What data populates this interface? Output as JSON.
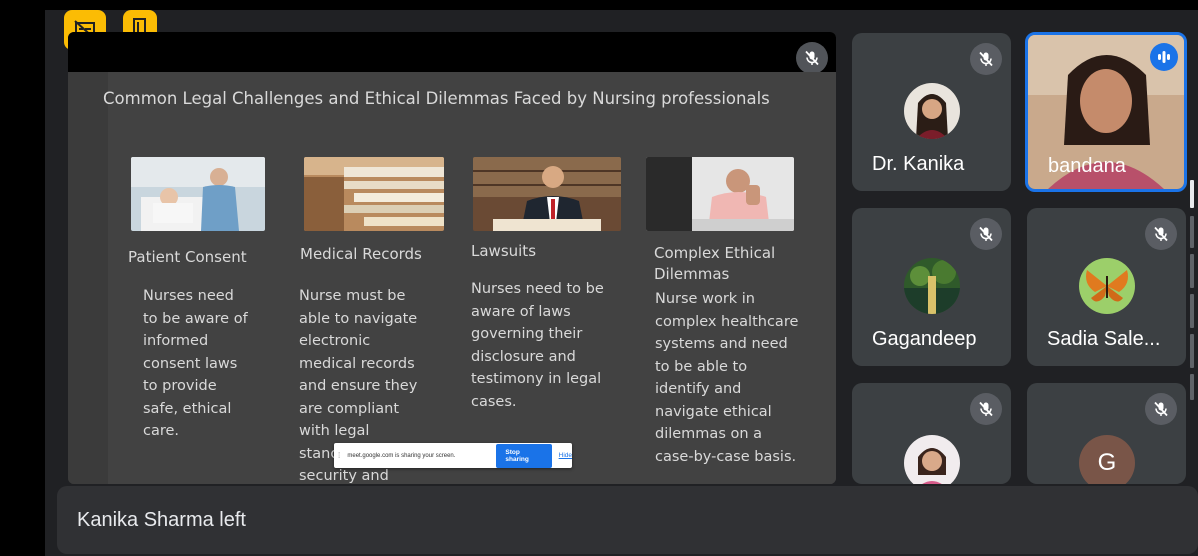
{
  "slide": {
    "title": "Common Legal Challenges and Ethical Dilemmas Faced by Nursing professionals",
    "columns": [
      {
        "heading": "Patient Consent",
        "body": [
          "Nurses need",
          "to be aware of",
          "informed",
          "consent laws",
          "to provide",
          "safe, ethical",
          "care."
        ]
      },
      {
        "heading": "Medical Records",
        "body": [
          "Nurse must be",
          "able to navigate",
          "electronic",
          "medical records",
          "and ensure they",
          "are compliant",
          "with legal",
          "standards for",
          "security and"
        ]
      },
      {
        "heading": "Lawsuits",
        "body": [
          "Nurses need to be",
          "aware of laws",
          "governing their",
          "disclosure and",
          "testimony in legal",
          "cases."
        ]
      },
      {
        "heading_lines": [
          "Complex Ethical",
          "Dilemmas"
        ],
        "body": [
          "Nurse work in",
          "complex healthcare",
          "systems and need",
          "to be able to",
          "identify and",
          "navigate ethical",
          "dilemmas on a",
          "case-by-case basis."
        ]
      }
    ]
  },
  "share_bar": {
    "message": "meet.google.com is sharing your screen.",
    "stop_label": "Stop sharing",
    "hide_label": "Hide"
  },
  "participants": [
    {
      "name": "Dr. Kanika"
    },
    {
      "name": "bandana"
    },
    {
      "name": "Gagandeep"
    },
    {
      "name": "Sadia Sale..."
    },
    {
      "name": ""
    },
    {
      "name": "",
      "initial": "G"
    }
  ],
  "toast": {
    "message": "Kanika Sharma left"
  },
  "icons": {
    "badge_left": "captions-off-icon",
    "badge_right": "door-icon",
    "mute": "mic-off-icon",
    "speaking": "audio-level-icon"
  },
  "colors": {
    "badge": "#fbbc04",
    "tile": "#3c4043",
    "speaking_border": "#1a73e8",
    "background": "#202124"
  }
}
